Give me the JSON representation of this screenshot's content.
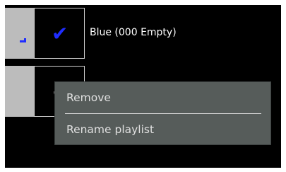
{
  "playlists": [
    {
      "name": "Blue (000 Empty)",
      "checked": true,
      "check_color": "#1f2dff"
    },
    {
      "name": "",
      "checked": true,
      "check_color": "#bcbcbc"
    }
  ],
  "context_menu": {
    "items": [
      {
        "label": "Remove"
      },
      {
        "label": "Rename playlist"
      }
    ]
  },
  "colors": {
    "background": "#000000",
    "swatch": "#bcbcbc",
    "accent_blue": "#1f2dff",
    "menu_bg": "#565c5a",
    "menu_text": "#e0e0e0"
  }
}
